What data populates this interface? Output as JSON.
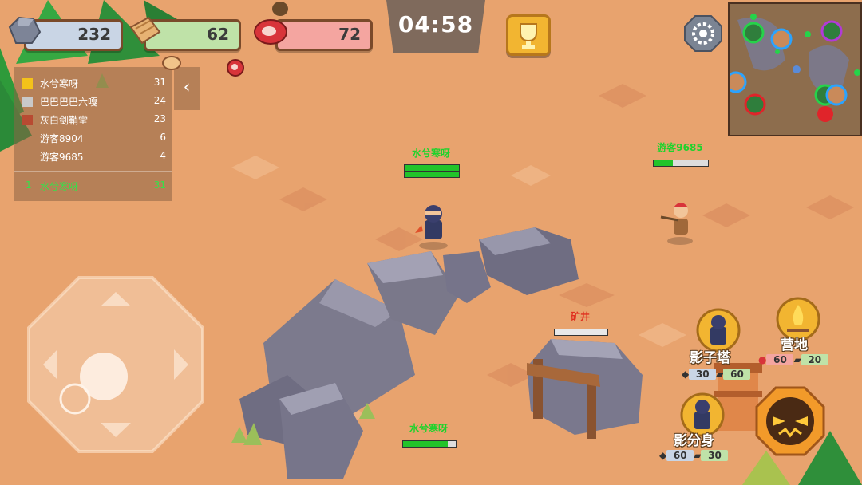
{
  "resources": {
    "stone": 232,
    "wood": 62,
    "meat": 72
  },
  "timer": "04:58",
  "leaderboard": {
    "rows": [
      {
        "name": "水兮寒呀",
        "score": 31,
        "color": "#f4c21a"
      },
      {
        "name": "巴巴巴巴六嘎",
        "score": 24,
        "color": "#c9c9c9"
      },
      {
        "name": "灰白剑鞘堂",
        "score": 23,
        "color": "#b84a32"
      },
      {
        "name": "游客8904",
        "score": 6,
        "color": ""
      },
      {
        "name": "游客9685",
        "score": 4,
        "color": ""
      }
    ],
    "self": {
      "rank": "1",
      "name": "水兮寒呀",
      "score": 31
    }
  },
  "units": {
    "player_top": {
      "name": "水兮寒呀",
      "name_color": "#1ed32c",
      "hp": 1.0
    },
    "enemy": {
      "name": "游客9685",
      "name_color": "#1ed32c",
      "hp": 0.35
    },
    "player_bottom": {
      "name": "水兮寒呀",
      "name_color": "#1ed32c",
      "hp": 0.85
    }
  },
  "mine": {
    "label": "矿井",
    "label_color": "#e03020",
    "hp": 0.0
  },
  "build": {
    "shadow_tower": {
      "label": "影子塔",
      "stone": 30,
      "wood": 60
    },
    "camp": {
      "label": "营地",
      "meat": 60,
      "wood": 20
    },
    "shadow_clone": {
      "label": "影分身",
      "stone": 60,
      "wood": 30
    }
  },
  "icons": {
    "stone": "stone-icon",
    "wood": "wood-icon",
    "meat": "meat-icon",
    "trophy": "trophy-icon",
    "settings": "gear-icon",
    "collapse": "chevron-left-icon",
    "joystick": "joystick-icon",
    "attack": "attack-icon"
  },
  "colors": {
    "ground": "#e8a36e",
    "accent_gold": "#f2b531",
    "team_green": "#1ed32c"
  }
}
